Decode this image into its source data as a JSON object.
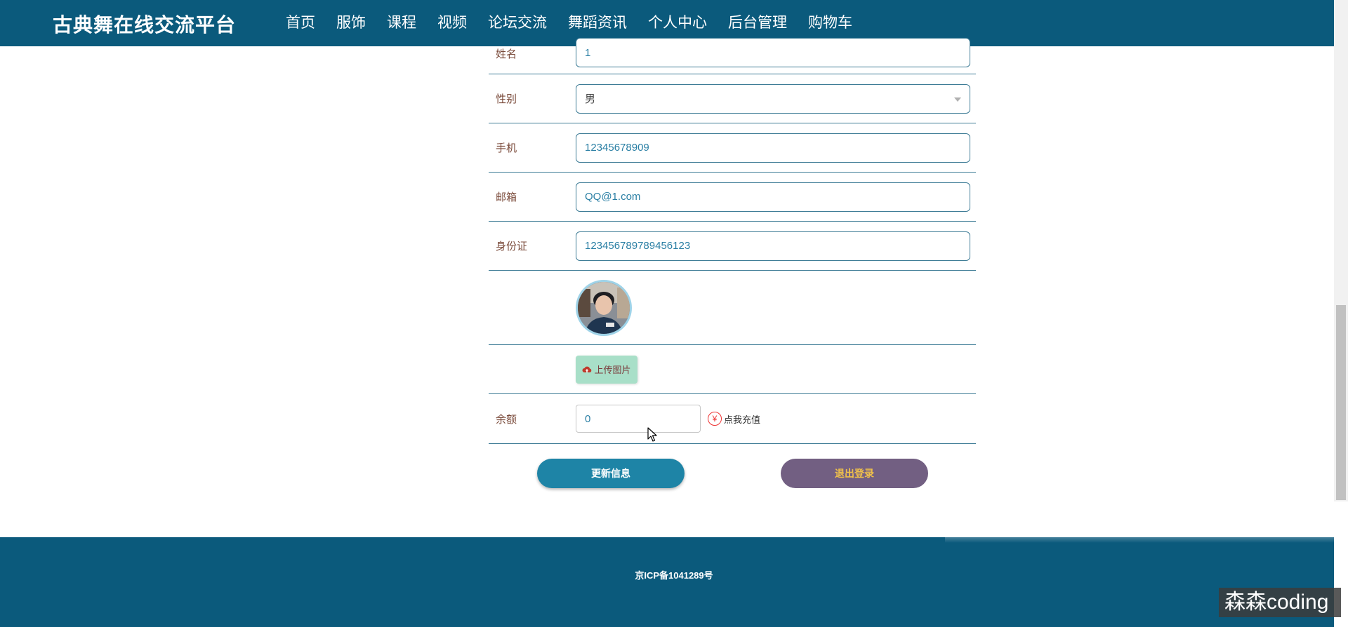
{
  "header": {
    "title": "古典舞在线交流平台",
    "nav": [
      "首页",
      "服饰",
      "课程",
      "视频",
      "论坛交流",
      "舞蹈资讯",
      "个人中心",
      "后台管理",
      "购物车"
    ],
    "active_index": 6
  },
  "form": {
    "name": {
      "label": "姓名",
      "value": "1"
    },
    "gender": {
      "label": "性别",
      "value": "男"
    },
    "phone": {
      "label": "手机",
      "value": "12345678909"
    },
    "email": {
      "label": "邮箱",
      "value": "QQ@1.com"
    },
    "id_card": {
      "label": "身份证",
      "value": "123456789789456123"
    },
    "upload_label": "上传图片",
    "balance": {
      "label": "余额",
      "value": "0"
    },
    "recharge_label": "点我充值"
  },
  "buttons": {
    "update": "更新信息",
    "logout": "退出登录"
  },
  "footer": {
    "icp": "京ICP备1041289号"
  },
  "watermark": "森森coding",
  "colors": {
    "primary": "#0b5a7c",
    "update_button": "#1e84a6",
    "logout_button": "#725f82",
    "logout_text": "#f0c14a",
    "upload_button": "#a8dfc8"
  }
}
